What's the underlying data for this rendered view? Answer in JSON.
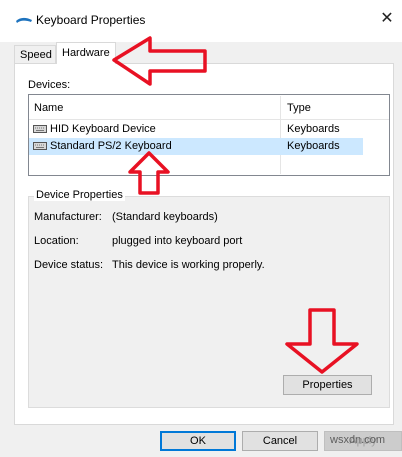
{
  "window": {
    "title": "Keyboard Properties",
    "close_glyph": "✕"
  },
  "tabs": [
    {
      "label": "Speed",
      "selected": false
    },
    {
      "label": "Hardware",
      "selected": true
    }
  ],
  "devices": {
    "label": "Devices:",
    "columns": {
      "name": "Name",
      "type": "Type"
    },
    "rows": [
      {
        "name": "HID Keyboard Device",
        "type": "Keyboards",
        "icon": "keyboard-icon",
        "selected": false
      },
      {
        "name": "Standard PS/2 Keyboard",
        "type": "Keyboards",
        "icon": "keyboard-icon",
        "selected": true
      }
    ]
  },
  "device_properties": {
    "title": "Device Properties",
    "manufacturer_label": "Manufacturer:",
    "manufacturer_value": "(Standard keyboards)",
    "location_label": "Location:",
    "location_value": "plugged into keyboard port",
    "status_label": "Device status:",
    "status_value": "This device is working properly.",
    "properties_button": "Properties"
  },
  "footer": {
    "ok": "OK",
    "cancel": "Cancel",
    "apply": "Apply"
  },
  "watermark": "wsxdn.com",
  "colors": {
    "annotation_arrow": "#e81123",
    "selection": "#cce8ff",
    "accent": "#0078d7"
  }
}
